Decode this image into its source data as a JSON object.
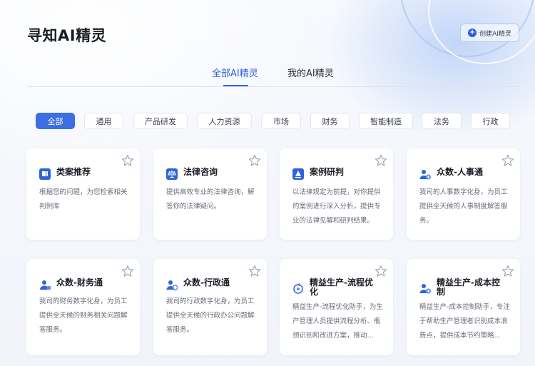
{
  "header": {
    "title": "寻知AI精灵",
    "create_label": "创建AI精灵"
  },
  "tabs": [
    {
      "label": "全部AI精灵",
      "active": true
    },
    {
      "label": "我的AI精灵",
      "active": false
    }
  ],
  "filters": [
    {
      "label": "全部",
      "active": true
    },
    {
      "label": "通用"
    },
    {
      "label": "产品研发"
    },
    {
      "label": "人力资源"
    },
    {
      "label": "市场"
    },
    {
      "label": "财务"
    },
    {
      "label": "智能制造"
    },
    {
      "label": "法务"
    },
    {
      "label": "行政"
    }
  ],
  "cards": [
    {
      "name": "类案推荐",
      "icon": "book-icon",
      "desc": "根据您的问题，为您检索相关判例库"
    },
    {
      "name": "法律咨询",
      "icon": "scales-icon",
      "desc": "提供高效专业的法律咨询，解答你的法律疑问。"
    },
    {
      "name": "案例研判",
      "icon": "gavel-icon",
      "desc": "以法律规定为前提，对你提供的案例进行深入分析，提供专业的法律见解和研判结果。"
    },
    {
      "name": "众数-人事通",
      "icon": "user-plus-icon",
      "desc": "我司的人事数字化身，为员工提供全天候的人事制度解答服务。"
    },
    {
      "name": "众数-财务通",
      "icon": "user-group-icon",
      "desc": "我司的财务数字化身，为员工提供全天候的财务相关问题解答服务。"
    },
    {
      "name": "众数-行政通",
      "icon": "user-gear-icon",
      "desc": "我司的行政数字化身，为员工提供全天候的行政办公问题解答服务。"
    },
    {
      "name": "精益生产-流程优化",
      "icon": "cycle-icon",
      "desc": "精益生产-流程优化助手，为生产管理人员提供流程分析、瓶颈识别和改进方案，推动..."
    },
    {
      "name": "精益生产-成本控制",
      "icon": "user-plus-icon",
      "desc": "精益生产-成本控制助手，专注于帮助生产管理者识别成本浪费点，提供成本节约策略..."
    }
  ],
  "colors": {
    "accent": "#2f63dd",
    "chip_active": "#3d6ee3"
  }
}
